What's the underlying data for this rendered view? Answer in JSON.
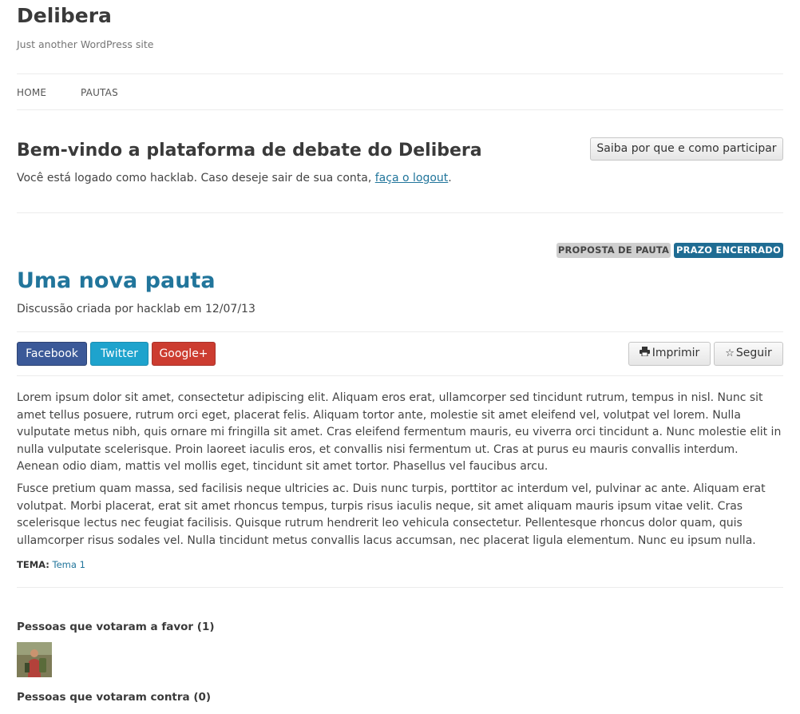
{
  "site": {
    "title": "Delibera",
    "description": "Just another WordPress site"
  },
  "nav": {
    "items": [
      "HOME",
      "PAUTAS"
    ]
  },
  "welcome": {
    "heading": "Bem-vindo a plataforma de debate do Delibera",
    "text_before": "Você está logado como hacklab. Caso deseje sair de sua conta, ",
    "logout_link": "faça o logout",
    "text_after": ".",
    "participar_button": "Saiba por que e como participar"
  },
  "post": {
    "badges": [
      "PROPOSTA DE PAUTA",
      "PRAZO ENCERRADO"
    ],
    "title": "Uma nova pauta",
    "meta": "Discussão criada por hacklab em 12/07/13",
    "share": {
      "facebook": "Facebook",
      "twitter": "Twitter",
      "googleplus": "Google+"
    },
    "actions": {
      "print": "Imprimir",
      "follow": "Seguir"
    },
    "paragraphs": [
      "Lorem ipsum dolor sit amet, consectetur adipiscing elit. Aliquam eros erat, ullamcorper sed tincidunt rutrum, tempus in nisl. Nunc sit amet tellus posuere, rutrum orci eget, placerat felis. Aliquam tortor ante, molestie sit amet eleifend vel, volutpat vel lorem. Nulla vulputate metus nibh, quis ornare mi fringilla sit amet. Cras eleifend fermentum mauris, eu viverra orci tincidunt a. Nunc molestie elit in nulla vulputate scelerisque. Proin laoreet iaculis eros, et convallis nisi fermentum ut. Cras at purus eu mauris convallis interdum. Aenean odio diam, mattis vel mollis eget, tincidunt sit amet tortor. Phasellus vel faucibus arcu.",
      "Fusce pretium quam massa, sed facilisis neque ultricies ac. Duis nunc turpis, porttitor ac interdum vel, pulvinar ac ante. Aliquam erat volutpat. Morbi placerat, erat sit amet rhoncus tempus, turpis risus iaculis neque, sit amet aliquam mauris ipsum vitae velit. Cras scelerisque lectus nec feugiat facilisis. Quisque rutrum hendrerit leo vehicula consectetur. Pellentesque rhoncus dolor quam, quis ullamcorper risus sodales vel. Nulla tincidunt metus convallis lacus accumsan, nec placerat ligula elementum. Nunc eu ipsum nulla."
    ],
    "tema_label": "TEMA:",
    "tema_value": "Tema 1"
  },
  "votes": {
    "favor_heading": "Pessoas que votaram a favor (1)",
    "contra_heading": "Pessoas que votaram contra (0)"
  },
  "colors": {
    "link": "#21759b",
    "badge_gray": "#cfcfcf",
    "badge_blue": "#1f6c93",
    "facebook": "#3b5998",
    "twitter": "#1ea3cd",
    "googleplus": "#cc3c30"
  }
}
